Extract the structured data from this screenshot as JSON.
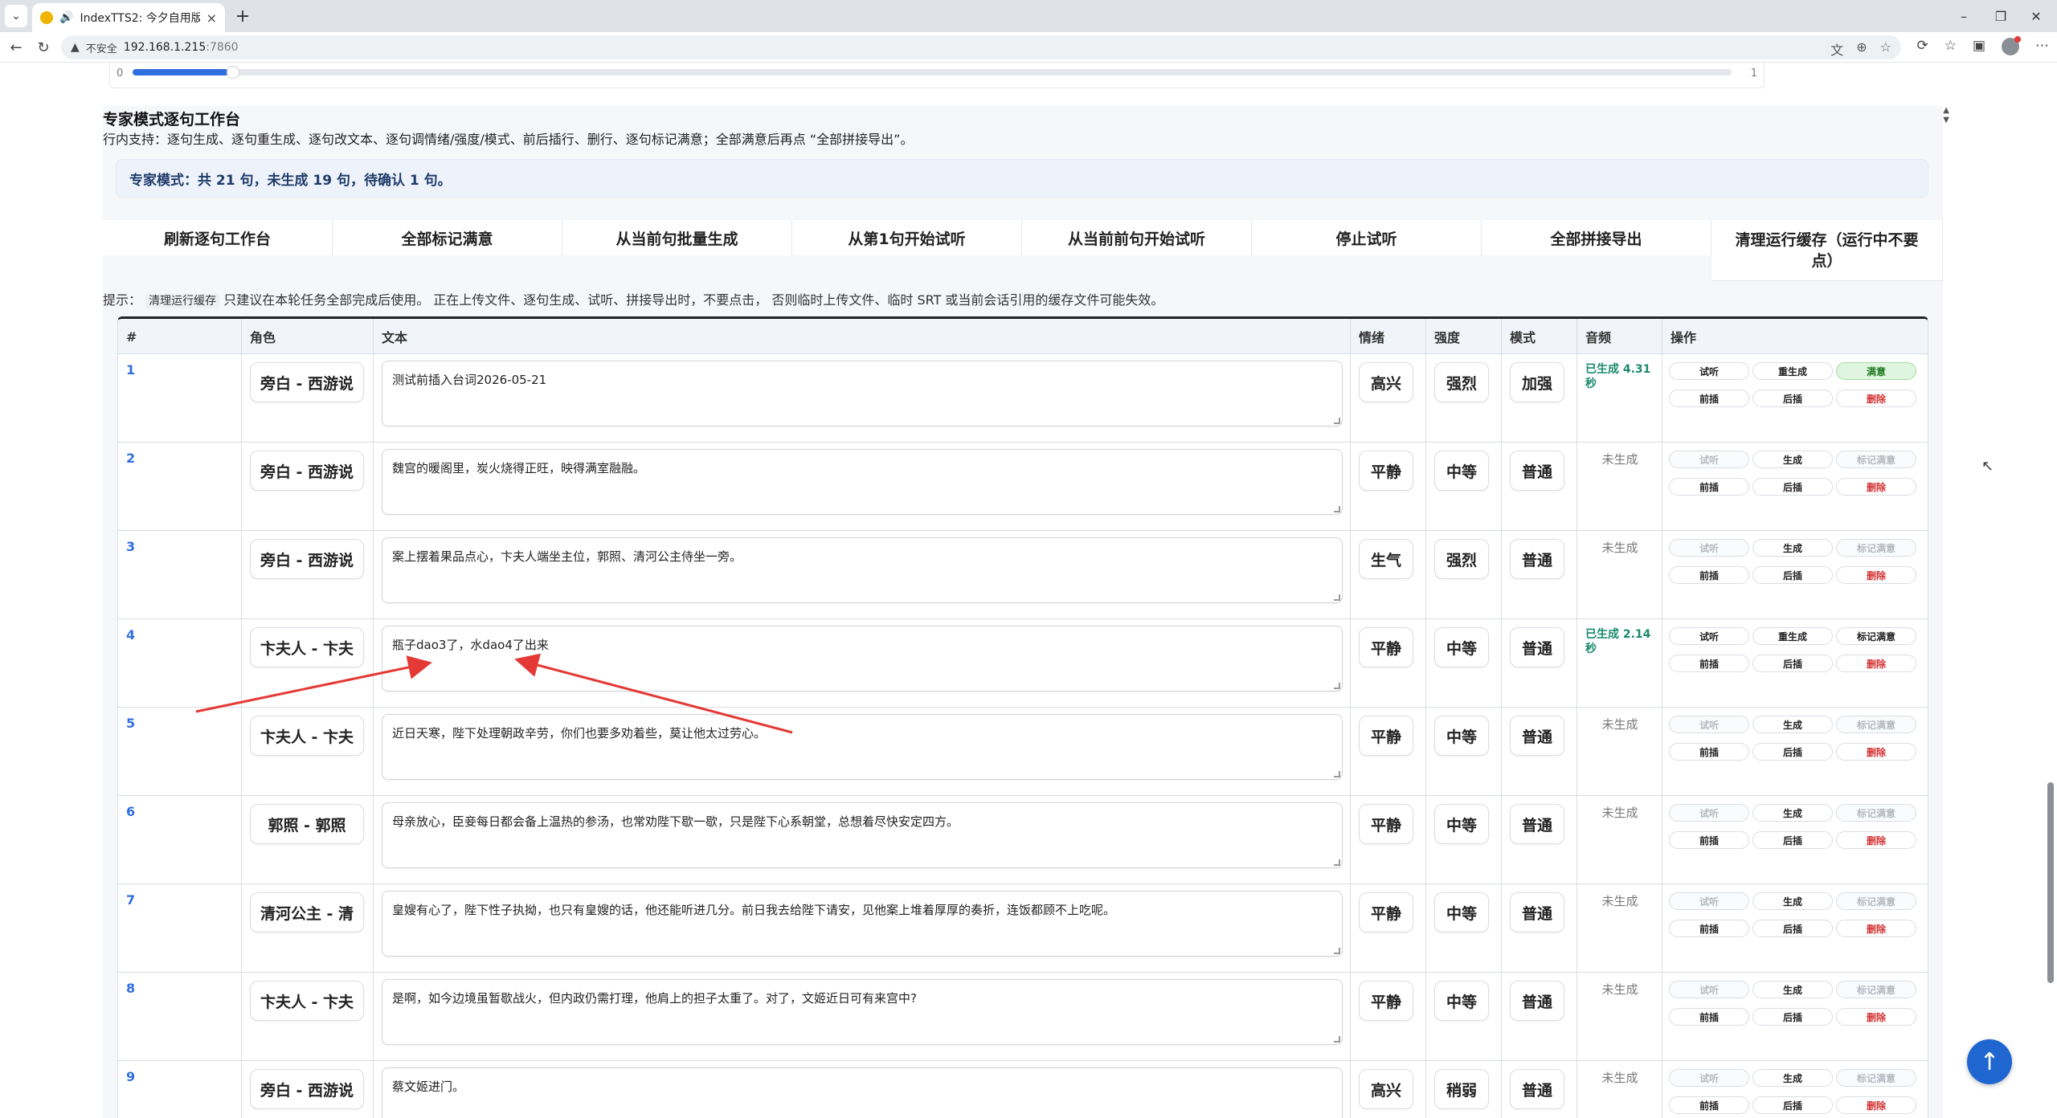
{
  "browser": {
    "tab_title": "IndexTTS2: 今夕自用版",
    "address_insecure": "不安全",
    "address_host": "192.168.1.215",
    "address_port": ":7860"
  },
  "progress": {
    "min": "0",
    "max": "1",
    "fraction": 0.06
  },
  "workbench": {
    "title": "专家模式逐句工作台",
    "description": "行内支持：逐句生成、逐句重生成、逐句改文本、逐句调情绪/强度/模式、前后插行、删行、逐句标记满意；全部满意后再点 “全部拼接导出”。",
    "summary": "专家模式：共 21 句，未生成 19 句，待确认 1 句。",
    "toolbar": [
      "刷新逐句工作台",
      "全部标记满意",
      "从当前句批量生成",
      "从第1句开始试听",
      "从当前前句开始试听",
      "停止试听",
      "全部拼接导出",
      "清理运行缓存（运行中不要点）"
    ],
    "hint_prefix": "提示：",
    "hint_code": "清理运行缓存",
    "hint_text": " 只建议在本轮任务全部完成后使用。 正在上传文件、逐句生成、试听、拼接导出时，不要点击， 否则临时上传文件、临时 SRT 或当前会话引用的缓存文件可能失效。"
  },
  "table": {
    "headers": [
      "#",
      "角色",
      "文本",
      "情绪",
      "强度",
      "模式",
      "音频",
      "操作"
    ],
    "rows": [
      {
        "idx": "1",
        "role": "旁白 - 西游说",
        "text": "测试前插入台词2026-05-21",
        "emotion": "高兴",
        "intensity": "强烈",
        "mode": "加强",
        "audio": "已生成 4.31 秒",
        "done": true,
        "ops": [
          "试听",
          "重生成",
          "满意",
          "前插",
          "后插",
          "删除"
        ]
      },
      {
        "idx": "2",
        "role": "旁白 - 西游说",
        "text": "魏宫的暖阁里，炭火烧得正旺，映得满室融融。",
        "emotion": "平静",
        "intensity": "中等",
        "mode": "普通",
        "audio": "未生成",
        "done": false,
        "ops": [
          "试听",
          "生成",
          "标记满意",
          "前插",
          "后插",
          "删除"
        ]
      },
      {
        "idx": "3",
        "role": "旁白 - 西游说",
        "text": "案上摆着果品点心，卞夫人端坐主位，郭照、清河公主侍坐一旁。",
        "emotion": "生气",
        "intensity": "强烈",
        "mode": "普通",
        "audio": "未生成",
        "done": false,
        "ops": [
          "试听",
          "生成",
          "标记满意",
          "前插",
          "后插",
          "删除"
        ]
      },
      {
        "idx": "4",
        "role": "卞夫人 - 卞夫",
        "text": "瓶子dao3了，水dao4了出来",
        "emotion": "平静",
        "intensity": "中等",
        "mode": "普通",
        "audio": "已生成 2.14 秒",
        "done": true,
        "ops": [
          "试听",
          "重生成",
          "标记满意",
          "前插",
          "后插",
          "删除"
        ]
      },
      {
        "idx": "5",
        "role": "卞夫人 - 卞夫",
        "text": "近日天寒，陛下处理朝政辛劳，你们也要多劝着些，莫让他太过劳心。",
        "emotion": "平静",
        "intensity": "中等",
        "mode": "普通",
        "audio": "未生成",
        "done": false,
        "ops": [
          "试听",
          "生成",
          "标记满意",
          "前插",
          "后插",
          "删除"
        ]
      },
      {
        "idx": "6",
        "role": "郭照 - 郭照",
        "text": "母亲放心，臣妾每日都会备上温热的参汤，也常劝陛下歇一歇，只是陛下心系朝堂，总想着尽快安定四方。",
        "emotion": "平静",
        "intensity": "中等",
        "mode": "普通",
        "audio": "未生成",
        "done": false,
        "ops": [
          "试听",
          "生成",
          "标记满意",
          "前插",
          "后插",
          "删除"
        ]
      },
      {
        "idx": "7",
        "role": "清河公主 - 清",
        "text": "皇嫂有心了，陛下性子执拗，也只有皇嫂的话，他还能听进几分。前日我去给陛下请安，见他案上堆着厚厚的奏折，连饭都顾不上吃呢。",
        "emotion": "平静",
        "intensity": "中等",
        "mode": "普通",
        "audio": "未生成",
        "done": false,
        "ops": [
          "试听",
          "生成",
          "标记满意",
          "前插",
          "后插",
          "删除"
        ]
      },
      {
        "idx": "8",
        "role": "卞夫人 - 卞夫",
        "text": "是啊，如今边境虽暂歇战火，但内政仍需打理，他肩上的担子太重了。对了，文姬近日可有来宫中?",
        "emotion": "平静",
        "intensity": "中等",
        "mode": "普通",
        "audio": "未生成",
        "done": false,
        "ops": [
          "试听",
          "生成",
          "标记满意",
          "前插",
          "后插",
          "删除"
        ]
      },
      {
        "idx": "9",
        "role": "旁白 - 西游说",
        "text": "蔡文姬进门。",
        "emotion": "高兴",
        "intensity": "稍弱",
        "mode": "普通",
        "audio": "未生成",
        "done": false,
        "ops": [
          "试听",
          "生成",
          "标记满意",
          "前插",
          "后插",
          "删除"
        ]
      }
    ]
  },
  "colors": {
    "accent": "#2f6fe0",
    "success": "#1a8a6c",
    "danger": "#d32f2f",
    "annotation": "#e53935"
  }
}
